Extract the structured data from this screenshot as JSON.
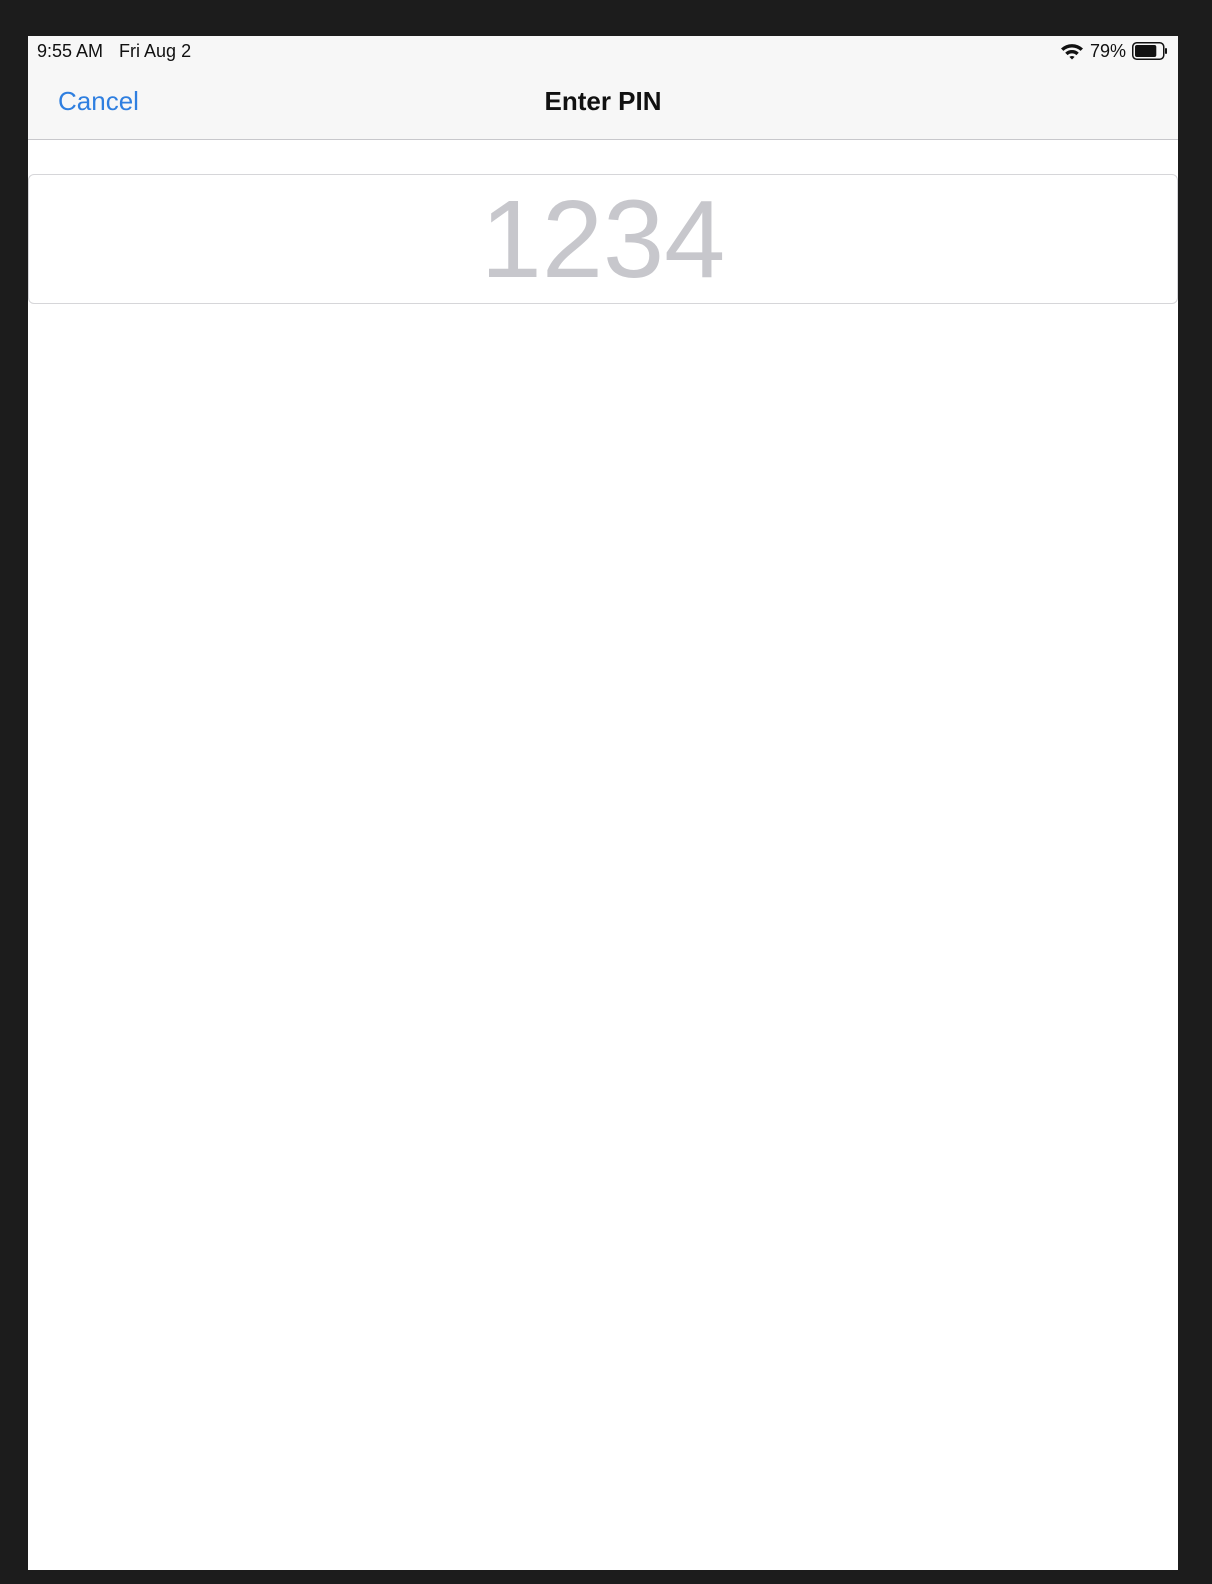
{
  "status_bar": {
    "time": "9:55 AM",
    "date": "Fri Aug 2",
    "battery_percent": "79%",
    "battery_level": 0.79,
    "icons": [
      "wifi-icon",
      "battery-icon"
    ]
  },
  "nav_bar": {
    "cancel_label": "Cancel",
    "title": "Enter PIN"
  },
  "pin_field": {
    "placeholder": "1234",
    "value": ""
  },
  "colors": {
    "accent": "#2f7fe0",
    "placeholder": "#c7c7cc",
    "bezel": "#1c1c1c",
    "bar_background": "#f7f7f7"
  }
}
